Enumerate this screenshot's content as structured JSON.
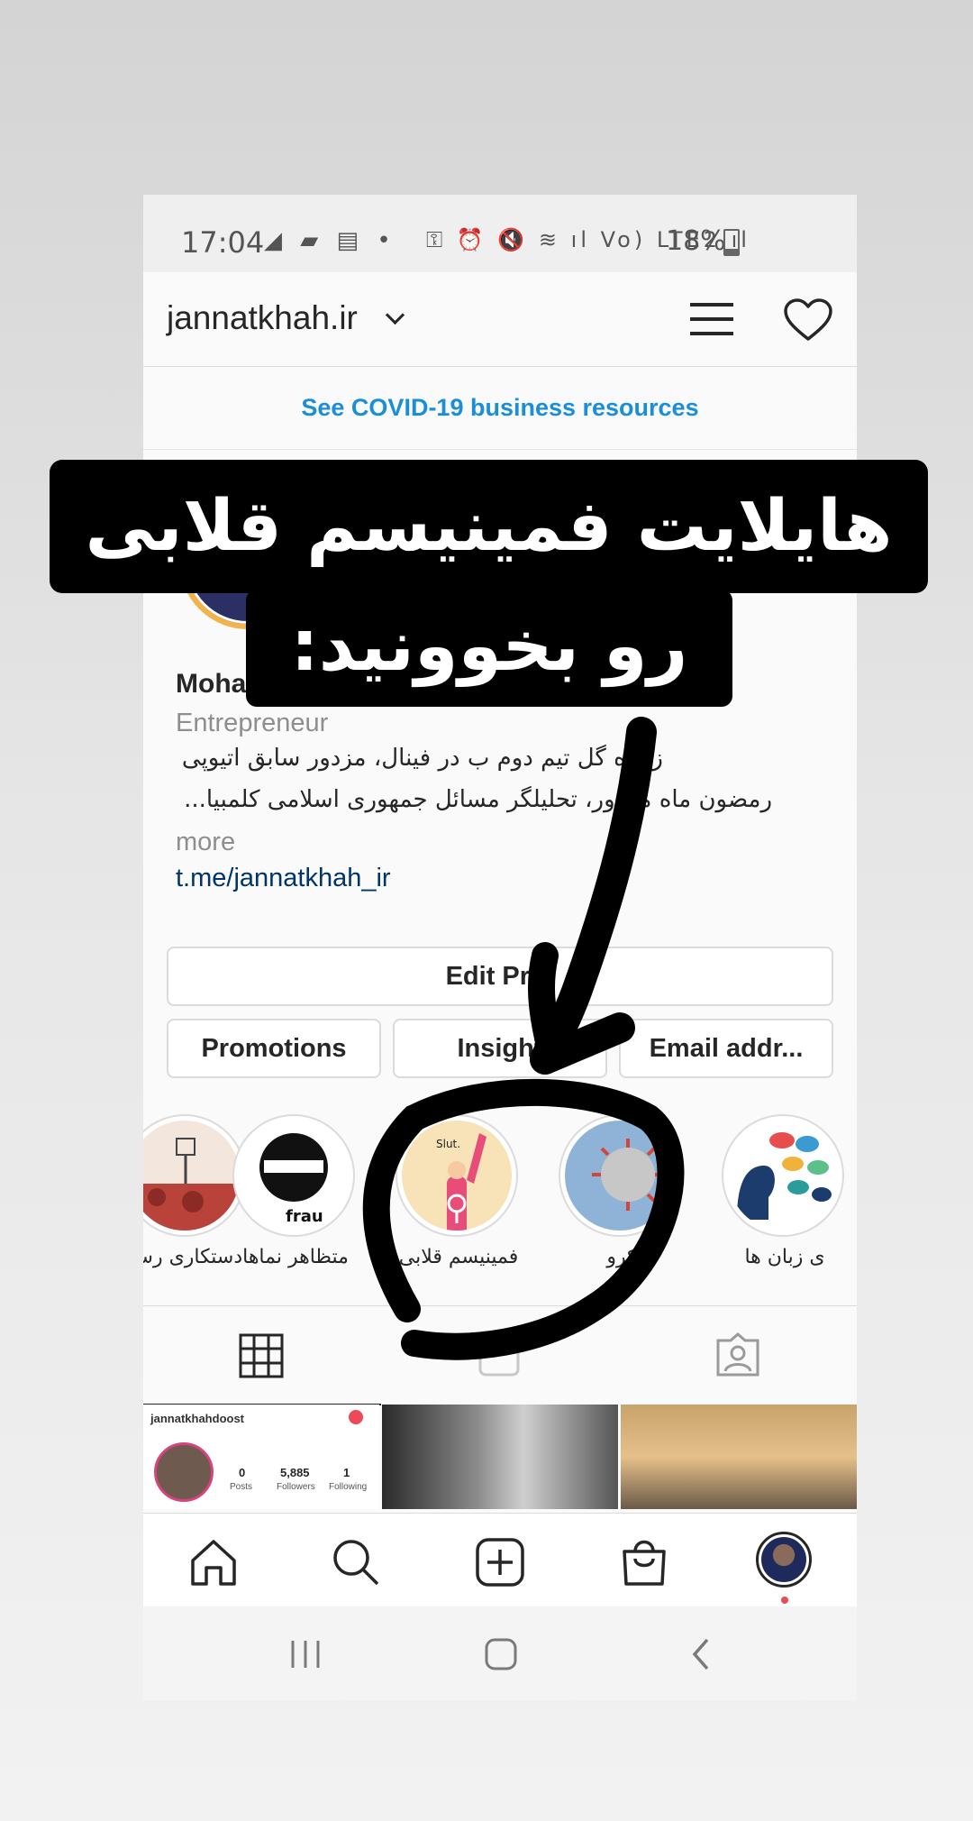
{
  "status_bar": {
    "time": "17:04",
    "left_icons": "◢ ▰ ▤ •",
    "right_icons": "⚿ ⏰ 🔇 ≋ ıl Vo) LTE2 ıl",
    "battery": "18%"
  },
  "header": {
    "username": "jannatkhah.ir",
    "menu_icon": "hamburger-icon",
    "activity_icon": "heart-icon"
  },
  "covid_banner": "See COVID-19 business resources",
  "profile": {
    "name": "Moha",
    "role": "Entrepreneur",
    "bio_line1": "زننده گل تیم دوم ب در فینال، مزدور سابق اتیوپی",
    "bio_line2": "رمضون ماه مغرور، تحلیلگر مسائل جمهوری اسلامی کلمبیا...",
    "more": "more",
    "link": "t.me/jannatkhah_ir"
  },
  "buttons": {
    "edit_profile": "Edit Prof",
    "promotions": "Promotions",
    "insights": "Insight",
    "email": "Email addr..."
  },
  "highlights": [
    {
      "label": "دستکاری رسا"
    },
    {
      "label": "متظاهر نماها"
    },
    {
      "label": "فمینیسم قلابی"
    },
    {
      "label": "کرو"
    },
    {
      "label": "ی زبان ها"
    }
  ],
  "highlight_art": {
    "slut_text": "Slut.",
    "fraud_text": "frau"
  },
  "grid_posts": {
    "post1": {
      "username": "jannatkhahdoost",
      "posts_count": "0",
      "posts_label": "Posts",
      "followers_count": "5,885",
      "followers_label": "Followers",
      "following_count": "1",
      "following_label": "Following"
    }
  },
  "overlay": {
    "line1": "هایلایت فمینیسم قلابی",
    "line2": "رو بخوونید:"
  },
  "colors": {
    "accent_blue": "#1a8ed6",
    "link_blue": "#003569",
    "notification_red": "#ed4956"
  }
}
